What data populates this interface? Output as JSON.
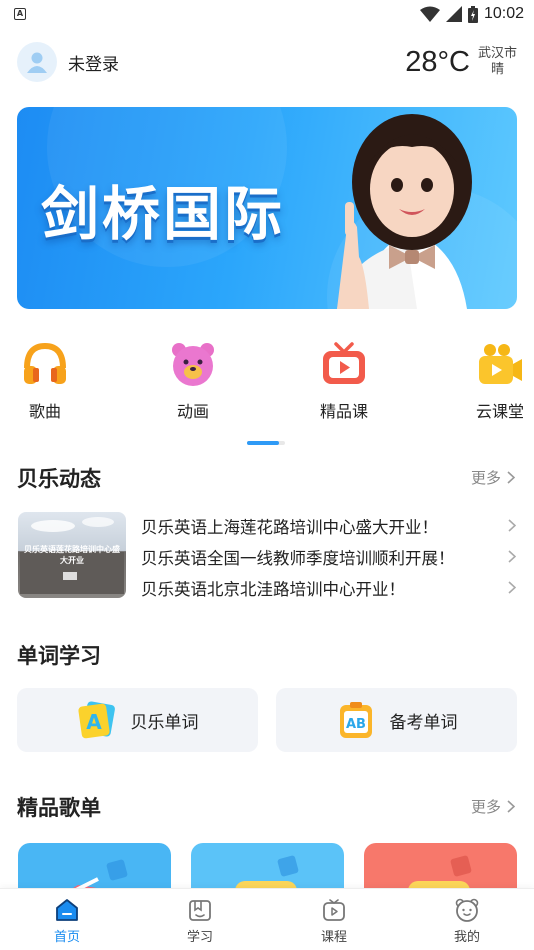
{
  "status_bar": {
    "left_icon": "notification-a-icon",
    "time": "10:02"
  },
  "header": {
    "login_text": "未登录",
    "temperature": "28°C",
    "city": "武汉市",
    "weather": "晴"
  },
  "banner": {
    "title": "剑桥国际"
  },
  "categories": [
    {
      "label": "歌曲",
      "icon": "headphones-icon"
    },
    {
      "label": "动画",
      "icon": "bear-icon"
    },
    {
      "label": "精品课",
      "icon": "tv-icon"
    },
    {
      "label": "云课堂",
      "icon": "camera-icon"
    }
  ],
  "news": {
    "title": "贝乐动态",
    "more": "更多",
    "thumb_text": "贝乐英语莲花路培训中心盛大开业",
    "items": [
      "贝乐英语上海莲花路培训中心盛大开业！",
      "贝乐英语全国一线教师季度培训顺利开展！",
      "贝乐英语北京北洼路培训中心开业！"
    ]
  },
  "words": {
    "title": "单词学习",
    "cards": [
      {
        "label": "贝乐单词",
        "icon": "letter-a-card-icon"
      },
      {
        "label": "备考单词",
        "icon": "ab-clipboard-icon"
      }
    ]
  },
  "playlist": {
    "title": "精品歌单",
    "more": "更多"
  },
  "tabbar": {
    "tabs": [
      {
        "label": "首页",
        "icon": "home-icon",
        "active": true
      },
      {
        "label": "学习",
        "icon": "book-icon",
        "active": false
      },
      {
        "label": "课程",
        "icon": "play-icon",
        "active": false
      },
      {
        "label": "我的",
        "icon": "bear-face-icon",
        "active": false
      }
    ]
  },
  "colors": {
    "accent": "#1a8cf0",
    "banner_start": "#1d8cf3",
    "banner_end": "#5ec9fe"
  }
}
